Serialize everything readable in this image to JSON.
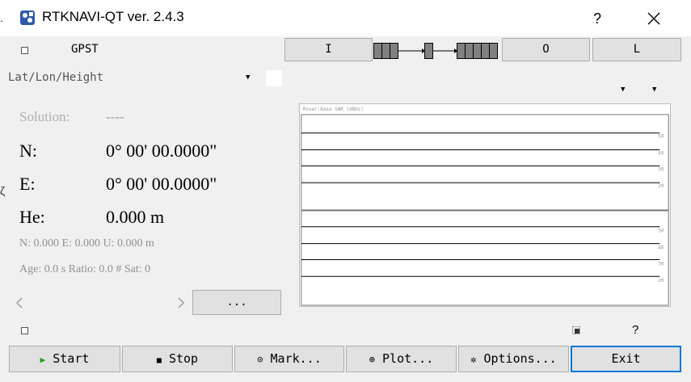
{
  "window": {
    "title": "RTKNAVI-QT ver. 2.4.3",
    "help_label": "?",
    "left_edge_text": ".",
    "left_edge_glyph": "ζ"
  },
  "top_row": {
    "time_system": "GPST",
    "input_button": "I",
    "output_button": "O",
    "log_button": "L"
  },
  "format": {
    "selected": "Lat/Lon/Height"
  },
  "solution": {
    "label": "Solution:",
    "status": "----",
    "lat_label": "N:",
    "lat_value": "0° 00' 00.0000\"",
    "lon_label": "E:",
    "lon_value": "0° 00' 00.0000\"",
    "height_label": "He:",
    "height_value": "0.000 m",
    "enu_line": "N: 0.000 E: 0.000 U: 0.000 m",
    "age_line": "Age: 0.0 s Ratio: 0.0 # Sat: 0"
  },
  "more_button": "...",
  "plot": {
    "title": "Rover:Base SNR (dBHz)",
    "ticks_top": [
      "50",
      "40",
      "30",
      "20"
    ],
    "ticks_bottom": [
      "50",
      "40",
      "30",
      "20"
    ]
  },
  "bottom": {
    "help_label": "?",
    "start_label": "Start",
    "stop_label": "Stop",
    "mark_label": "Mark...",
    "plot_label": "Plot...",
    "options_label": "Options...",
    "exit_label": "Exit"
  },
  "colors": {
    "start_green": "#1aa31a",
    "exit_border": "#0078d7",
    "plot_line": "#000000"
  }
}
